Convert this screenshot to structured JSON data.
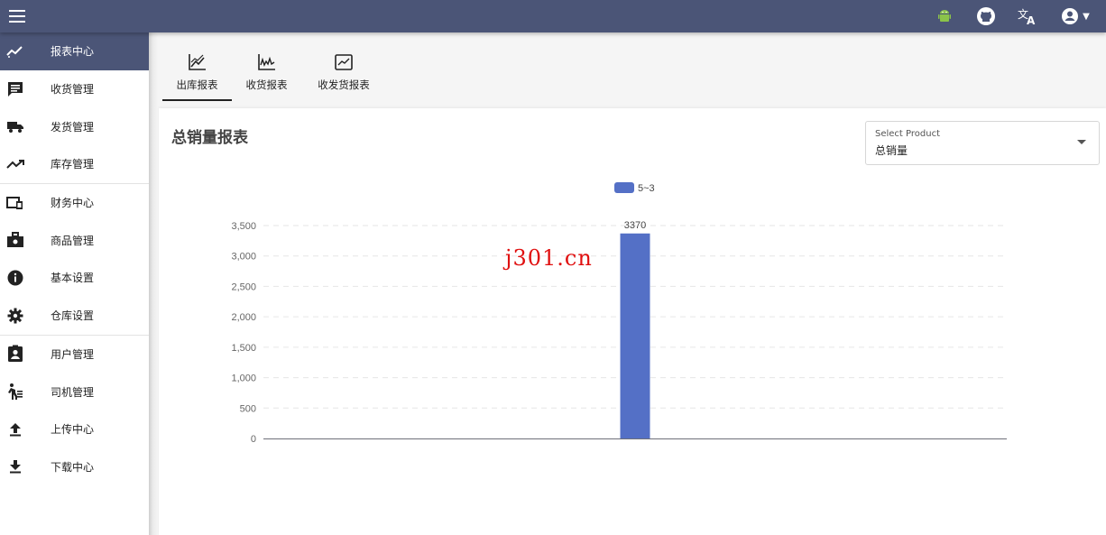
{
  "watermark": "j301.cn",
  "sidebar": {
    "items": [
      {
        "label": "报表中心",
        "icon": "chart-trend-icon",
        "active": true
      },
      {
        "label": "收货管理",
        "icon": "message-list-icon"
      },
      {
        "label": "发货管理",
        "icon": "truck-icon"
      },
      {
        "label": "库存管理",
        "icon": "trending-icon"
      },
      {
        "label": "财务中心",
        "icon": "devices-icon"
      },
      {
        "label": "商品管理",
        "icon": "briefcase-icon"
      },
      {
        "label": "基本设置",
        "icon": "info-icon"
      },
      {
        "label": "仓库设置",
        "icon": "gear-icon"
      },
      {
        "label": "用户管理",
        "icon": "contact-badge-icon"
      },
      {
        "label": "司机管理",
        "icon": "driver-walk-icon"
      },
      {
        "label": "上传中心",
        "icon": "upload-icon"
      },
      {
        "label": "下载中心",
        "icon": "download-icon"
      }
    ]
  },
  "topbar": {
    "icons": [
      "menu-icon",
      "android-icon",
      "github-icon",
      "translate-icon",
      "account-circle-icon"
    ]
  },
  "tabs": [
    {
      "label": "出库报表",
      "icon": "chart-line-icon",
      "active": true
    },
    {
      "label": "收货报表",
      "icon": "chart-wave-icon"
    },
    {
      "label": "收发货报表",
      "icon": "chart-box-icon"
    }
  ],
  "card": {
    "title": "总销量报表",
    "select": {
      "label": "Select Product",
      "value": "总销量"
    }
  },
  "colors": {
    "accent": "#4b5577",
    "bar": "#5470c6"
  },
  "chart_data": {
    "type": "bar",
    "legend": [
      "5~3"
    ],
    "legend_position": "top-center",
    "categories": [
      "",
      "",
      "",
      "",
      "",
      "",
      "",
      "",
      "",
      "",
      "",
      "",
      "",
      "",
      "",
      "",
      "",
      "",
      "",
      "",
      "",
      "",
      "",
      "",
      ""
    ],
    "series": [
      {
        "name": "5~3",
        "values": [
          0,
          0,
          0,
          0,
          0,
          0,
          0,
          0,
          0,
          0,
          0,
          0,
          3370,
          0,
          0,
          0,
          0,
          0,
          0,
          0,
          0,
          0,
          0,
          0,
          0
        ],
        "color": "#5470c6"
      }
    ],
    "data_labels": [
      "3370"
    ],
    "yticks": [
      "0",
      "500",
      "1,000",
      "1,500",
      "2,000",
      "2,500",
      "3,000",
      "3,500"
    ],
    "ylim": [
      0,
      3500
    ],
    "grid": true
  }
}
